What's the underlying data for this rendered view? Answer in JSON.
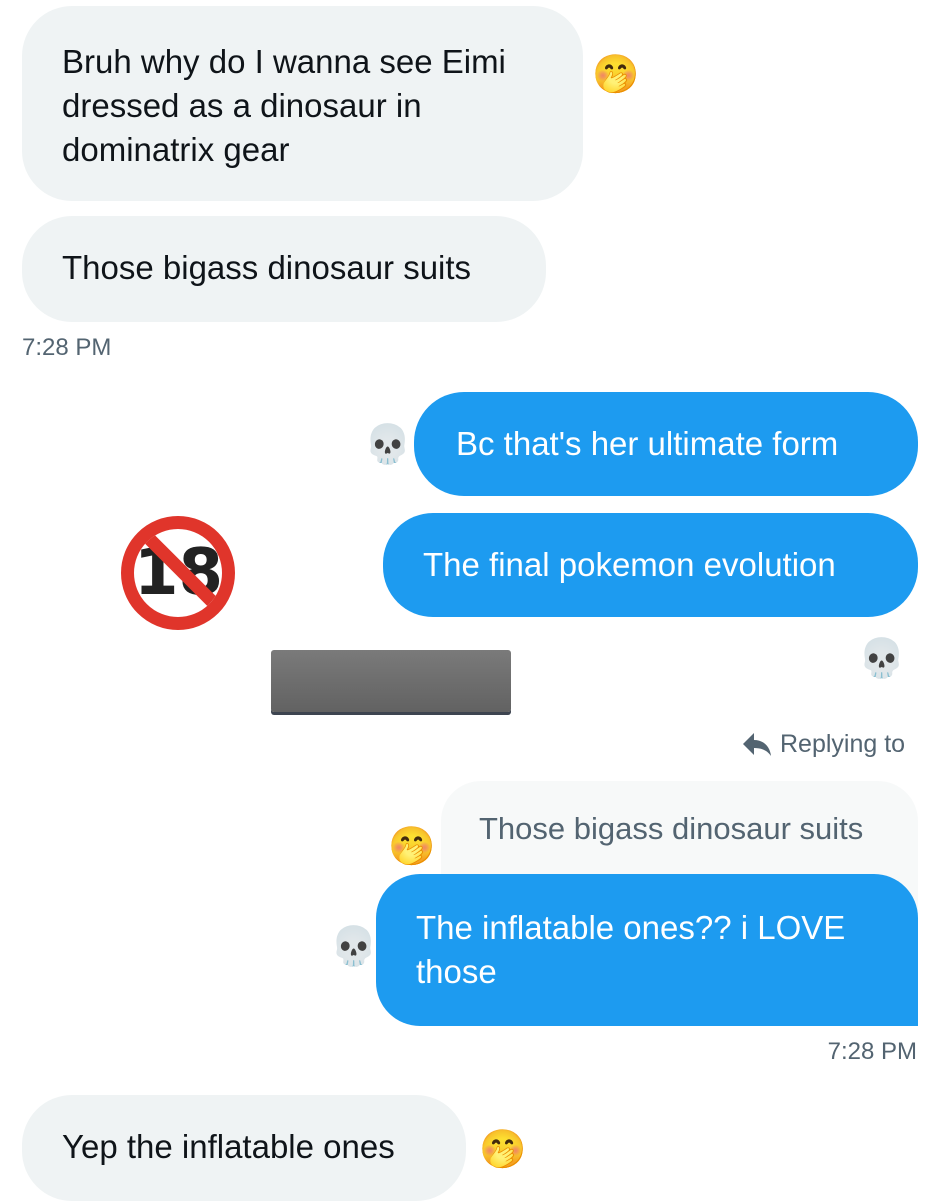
{
  "messages": {
    "m1": "Bruh why do I wanna see Eimi dressed as a dinosaur in dominatrix gear",
    "m2": "Those bigass dinosaur suits",
    "ts1": "7:28 PM",
    "m3": "Bc that's her ultimate form",
    "m4": "The final pokemon evolution",
    "replying_to_label": "Replying to",
    "quoted": "Those bigass dinosaur suits",
    "m5": "The inflatable ones?? i LOVE those",
    "ts2": "7:28 PM",
    "m6": "Yep the inflatable ones"
  },
  "reactions": {
    "face_with_hand": "🤭",
    "skull": "💀"
  },
  "badge": {
    "text": "18"
  },
  "colors": {
    "sent_bubble": "#1d9bf0",
    "received_bubble": "#eff3f4",
    "quote_bubble": "#f7f9f9",
    "badge_red": "#e0352b",
    "timestamp": "#536471"
  }
}
